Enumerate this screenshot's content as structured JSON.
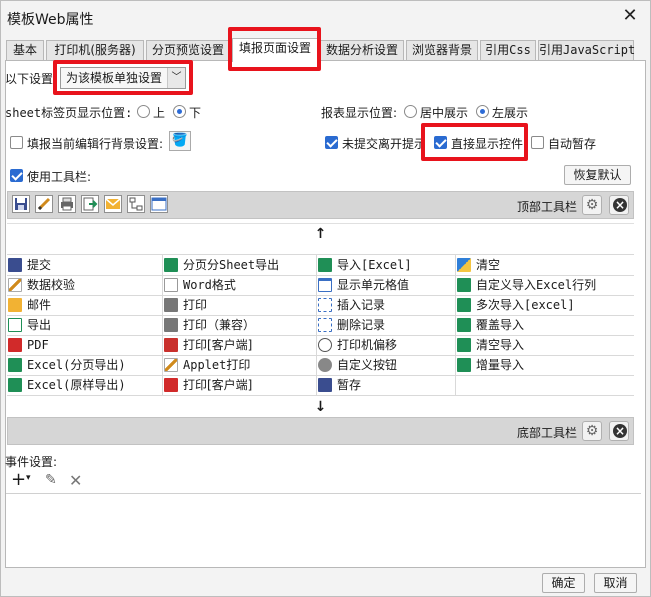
{
  "window": {
    "title": "模板Web属性"
  },
  "tabs": [
    {
      "label": "基本"
    },
    {
      "label": "打印机(服务器)"
    },
    {
      "label": "分页预览设置"
    },
    {
      "label": "填报页面设置"
    },
    {
      "label": "数据分析设置"
    },
    {
      "label": "浏览器背景"
    },
    {
      "label": "引用Css"
    },
    {
      "label": "引用JavaScript"
    }
  ],
  "active_tab": "填报页面设置",
  "settings": {
    "scope_label": "以下设置",
    "scope_value": "为该模板单独设置",
    "sheet_pos_label": "sheet标签页显示位置:",
    "sheet_pos_top": "上",
    "sheet_pos_bottom": "下",
    "sheet_pos_selected": "下",
    "report_pos_label": "报表显示位置:",
    "report_pos_center": "居中展示",
    "report_pos_left": "左展示",
    "report_pos_selected": "左展示",
    "fill_bg_label": "填报当前编辑行背景设置:",
    "fill_bg_checked": false,
    "unsubmitted_label": "未提交离开提示",
    "unsubmitted_checked": true,
    "direct_show_label": "直接显示控件",
    "direct_show_checked": true,
    "autosave_label": "自动暂存",
    "autosave_checked": false,
    "use_toolbar_label": "使用工具栏:",
    "use_toolbar_checked": true,
    "restore_default": "恢复默认"
  },
  "top_toolbar": {
    "label": "顶部工具栏",
    "icons": [
      "save-icon",
      "pencil-icon",
      "printer-icon",
      "export-icon",
      "mail-icon",
      "node-icon",
      "window-icon"
    ]
  },
  "bottom_toolbar": {
    "label": "底部工具栏"
  },
  "buttons_grid": [
    [
      {
        "label": "提交",
        "icon": "save-icon"
      },
      {
        "label": "分页分Sheet导出",
        "icon": "excel-icon"
      },
      {
        "label": "导入[Excel]",
        "icon": "excel-icon"
      },
      {
        "label": "清空",
        "icon": "eraser-icon"
      }
    ],
    [
      {
        "label": "数据校验",
        "icon": "pencil-icon"
      },
      {
        "label": "Word格式",
        "icon": "word-icon"
      },
      {
        "label": "显示单元格值",
        "icon": "window-icon"
      },
      {
        "label": "自定义导入Excel行列",
        "icon": "excel-icon"
      }
    ],
    [
      {
        "label": "邮件",
        "icon": "mail-icon"
      },
      {
        "label": "打印",
        "icon": "printer-icon"
      },
      {
        "label": "插入记录",
        "icon": "node-icon"
      },
      {
        "label": "多次导入[excel]",
        "icon": "excel-icon"
      }
    ],
    [
      {
        "label": "导出",
        "icon": "export-icon"
      },
      {
        "label": "打印（兼容）",
        "icon": "printer-icon"
      },
      {
        "label": "删除记录",
        "icon": "node-icon"
      },
      {
        "label": "覆盖导入",
        "icon": "excel-icon"
      }
    ],
    [
      {
        "label": "PDF",
        "icon": "pdf-icon"
      },
      {
        "label": "打印[客户端]",
        "icon": "flash-icon"
      },
      {
        "label": "打印机偏移",
        "icon": "move-icon"
      },
      {
        "label": "清空导入",
        "icon": "excel-icon"
      }
    ],
    [
      {
        "label": "Excel(分页导出)",
        "icon": "excel-icon"
      },
      {
        "label": "Applet打印",
        "icon": "pencil-icon"
      },
      {
        "label": "自定义按钮",
        "icon": "gear-icon"
      },
      {
        "label": "增量导入",
        "icon": "excel-icon"
      }
    ],
    [
      {
        "label": "Excel(原样导出)",
        "icon": "excel-icon"
      },
      {
        "label": "打印[客户端]",
        "icon": "pdf-icon"
      },
      {
        "label": "暂存",
        "icon": "save-icon"
      },
      {
        "label": "",
        "icon": ""
      }
    ]
  ],
  "events": {
    "label": "事件设置:"
  },
  "footer": {
    "ok": "确定",
    "cancel": "取消"
  },
  "colors": {
    "highlight": "#e8131c",
    "check_blue": "#2a6bd1",
    "excel_green": "#1f8f56"
  }
}
